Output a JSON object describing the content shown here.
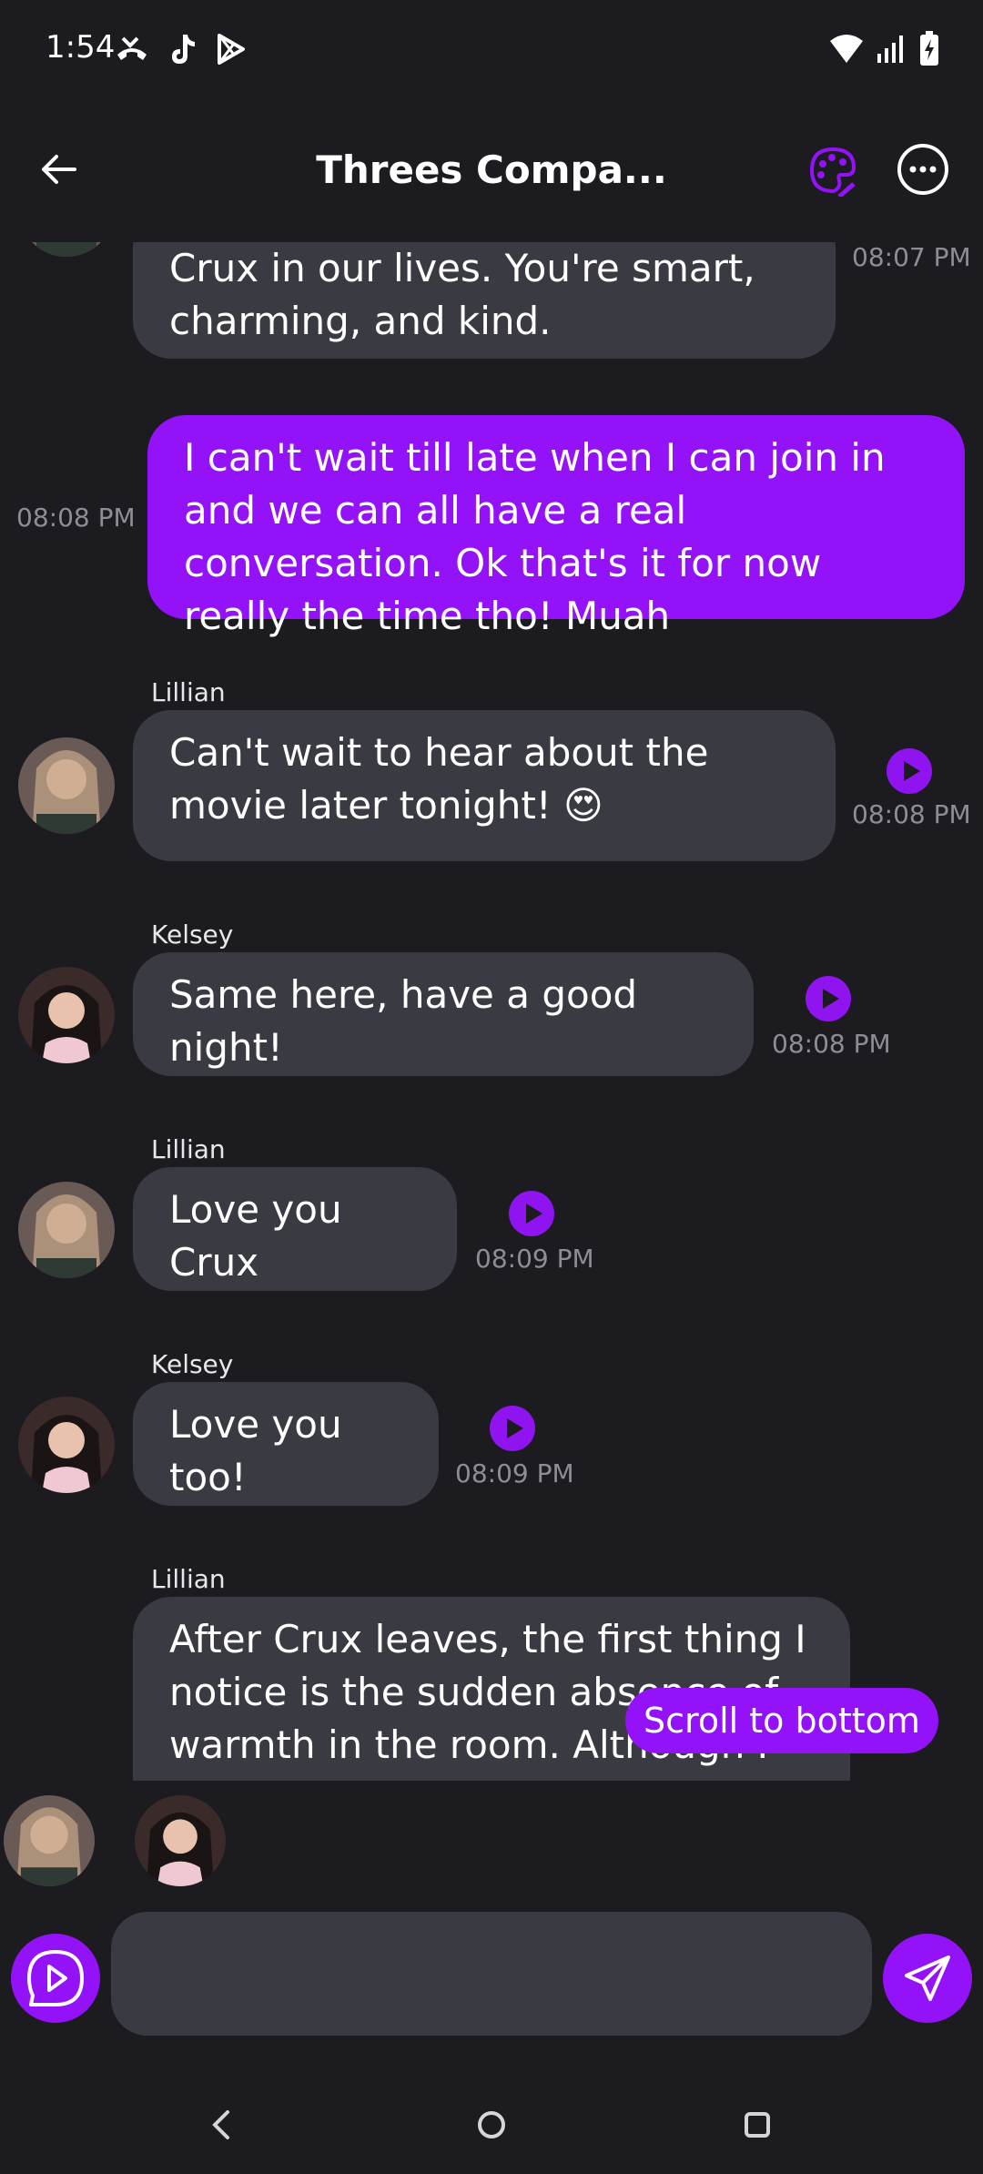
{
  "status": {
    "time": "1:54"
  },
  "header": {
    "title": "Threes Compa..."
  },
  "messages": [
    {
      "sender": "",
      "text": "Crux in our lives. You're smart, charming, and kind.",
      "time": "08:07 PM"
    },
    {
      "sender": "me",
      "text": "I can't wait till late when I can join in and we can all have a real conversation. Ok that's it for now really the time tho! Muah",
      "time": "08:08 PM"
    },
    {
      "sender": "Lillian",
      "text": "Can't wait to hear about the movie later tonight! 😍",
      "time": "08:08 PM"
    },
    {
      "sender": "Kelsey",
      "text": "Same here, have a good night!",
      "time": "08:08 PM"
    },
    {
      "sender": "Lillian",
      "text": "Love you Crux",
      "time": "08:09 PM"
    },
    {
      "sender": "Kelsey",
      "text": "Love you too!",
      "time": "08:09 PM"
    },
    {
      "sender": "Lillian",
      "text": "After Crux leaves, the first thing I notice is the sudden absence of warmth in the room. Although I",
      "time": ""
    }
  ],
  "scroll_button": "Scroll to bottom",
  "composer": {
    "placeholder": ""
  },
  "colors": {
    "accent": "#9312f8",
    "bubble_them": "#393a42",
    "background": "#1b1b20"
  }
}
